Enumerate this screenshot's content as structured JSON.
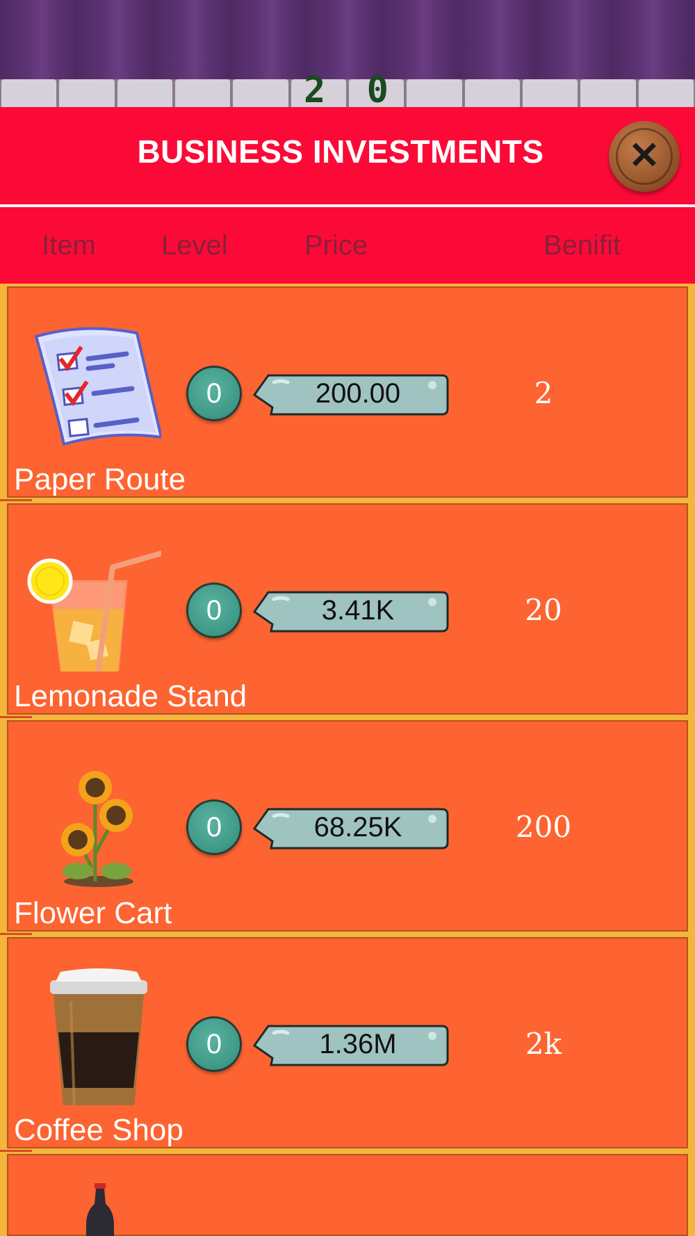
{
  "header": {
    "score_digits": "2 0",
    "title": "BUSINESS INVESTMENTS",
    "close_symbol": "✕"
  },
  "columns": {
    "item": "Item",
    "level": "Level",
    "price": "Price",
    "benefit": "Benifit"
  },
  "items": [
    {
      "name": "Paper Route",
      "level": "0",
      "price": "200.00",
      "benefit": "2",
      "icon": "checklist-icon"
    },
    {
      "name": "Lemonade Stand",
      "level": "0",
      "price": "3.41K",
      "benefit": "20",
      "icon": "lemonade-icon"
    },
    {
      "name": "Flower Cart",
      "level": "0",
      "price": "68.25K",
      "benefit": "200",
      "icon": "sunflower-icon"
    },
    {
      "name": "Coffee Shop",
      "level": "0",
      "price": "1.36M",
      "benefit": "2k",
      "icon": "coffee-cup-icon"
    }
  ],
  "colors": {
    "header_red": "#fc0a37",
    "row_orange": "#fd6431",
    "list_background": "#f4b53c",
    "level_teal": "#3e9886",
    "price_tag": "#9fc3c0"
  }
}
